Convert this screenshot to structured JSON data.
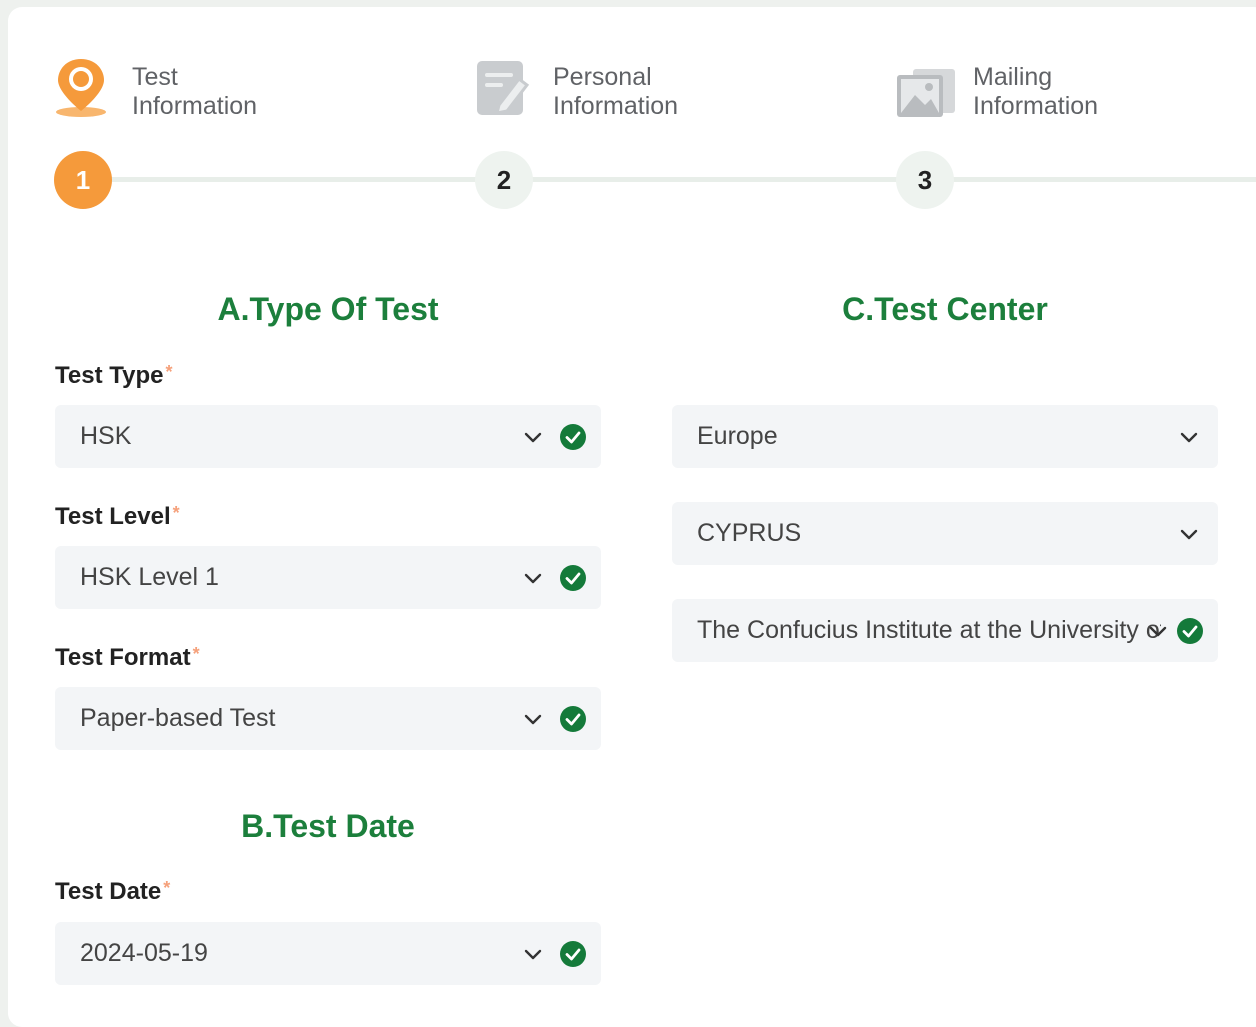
{
  "steps": [
    {
      "number": "1",
      "line1": "Test",
      "line2": "Information",
      "icon": "location-pin-icon",
      "state": "active"
    },
    {
      "number": "2",
      "line1": "Personal",
      "line2": "Information",
      "icon": "edit-form-icon",
      "state": "todo"
    },
    {
      "number": "3",
      "line1": "Mailing",
      "line2": "Information",
      "icon": "image-mail-icon",
      "state": "todo"
    }
  ],
  "section_a": {
    "title": "A.Type Of Test",
    "test_type": {
      "label": "Test Type",
      "required_mark": "*",
      "value": "HSK"
    },
    "test_level": {
      "label": "Test Level",
      "required_mark": "*",
      "value": "HSK Level 1"
    },
    "test_format": {
      "label": "Test Format",
      "required_mark": "*",
      "value": "Paper-based Test"
    }
  },
  "section_b": {
    "title": "B.Test Date",
    "test_date": {
      "label": "Test Date",
      "required_mark": "*",
      "value": "2024-05-19"
    }
  },
  "section_c": {
    "title": "C.Test Center",
    "region": {
      "value": "Europe"
    },
    "country": {
      "value": "CYPRUS"
    },
    "center": {
      "value": "The Confucius Institute at the University of Cyprus"
    }
  },
  "colors": {
    "accent_orange": "#f59a3b",
    "section_green": "#1c7f3c",
    "check_green": "#147a3a"
  }
}
